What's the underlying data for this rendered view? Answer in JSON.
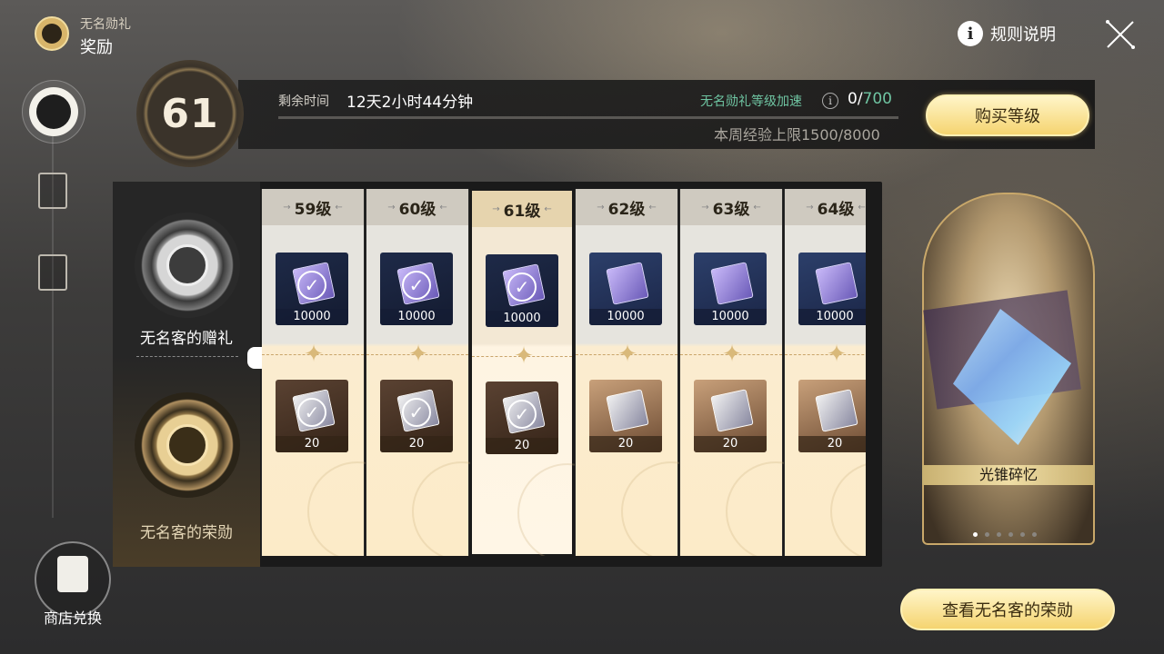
{
  "header": {
    "subtitle": "无名勋礼",
    "title": "奖励",
    "rules_label": "规则说明",
    "rules_icon": "info-icon",
    "close_icon": "close-icon"
  },
  "nav": {
    "shop_label": "商店兑换"
  },
  "level": {
    "current": "61",
    "time_label": "剩余时间",
    "time_value": "12天2小时44分钟",
    "accel_label": "无名勋礼等级加速",
    "accel_current": "0/",
    "accel_max": "700",
    "weekly_exp": "本周经验上限1500/8000",
    "buy_button": "购买等级"
  },
  "tracks": {
    "free_name": "无名客的赠礼",
    "paid_name": "无名客的荣勋"
  },
  "levels": [
    {
      "label": "59级",
      "free_qty": "10000",
      "paid_qty": "20",
      "claimed": true,
      "current": false
    },
    {
      "label": "60级",
      "free_qty": "10000",
      "paid_qty": "20",
      "claimed": true,
      "current": false
    },
    {
      "label": "61级",
      "free_qty": "10000",
      "paid_qty": "20",
      "claimed": true,
      "current": true
    },
    {
      "label": "62级",
      "free_qty": "10000",
      "paid_qty": "20",
      "claimed": false,
      "current": false
    },
    {
      "label": "63级",
      "free_qty": "10000",
      "paid_qty": "20",
      "claimed": false,
      "current": false
    },
    {
      "label": "64级",
      "free_qty": "10000",
      "paid_qty": "20",
      "claimed": false,
      "current": false
    }
  ],
  "showcase": {
    "name": "光锥碎忆",
    "page_count": 6,
    "active_page": 1,
    "honor_button": "查看无名客的荣勋"
  },
  "colors": {
    "accent_green": "#6fc5a2",
    "gold_button": "#f5d470"
  }
}
